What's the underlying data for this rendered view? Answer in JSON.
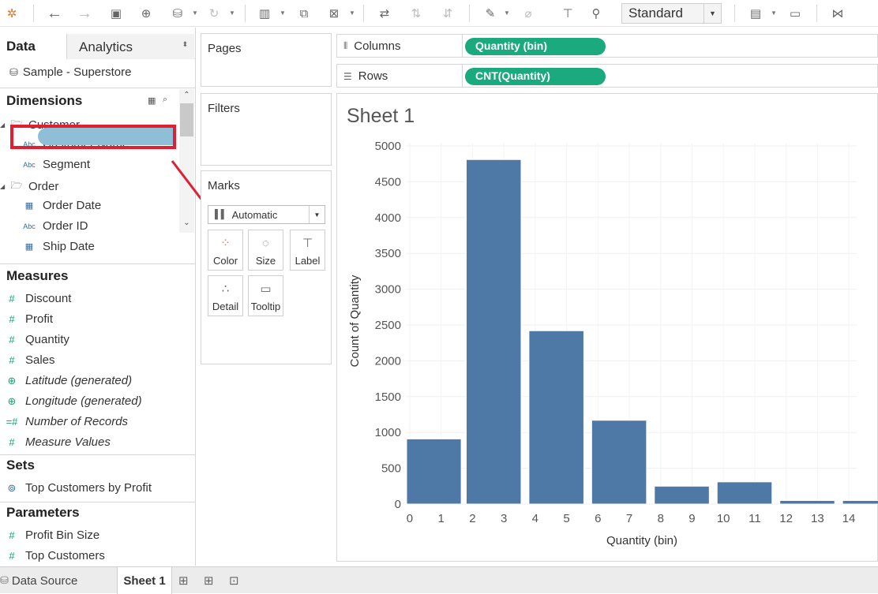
{
  "toolbar": {
    "view_mode": "Standard"
  },
  "data_pane": {
    "tab_data": "Data",
    "tab_analytics": "Analytics",
    "datasource": "Sample - Superstore",
    "dimensions_header": "Dimensions",
    "dimensions": {
      "customer_folder": "Customer",
      "customer_name": "Customer Name",
      "segment": "Segment",
      "order_folder": "Order",
      "order_date": "Order Date",
      "order_id": "Order ID",
      "ship_date": "Ship Date"
    },
    "type_abc": "Abc",
    "measures_header": "Measures",
    "measures": [
      "Discount",
      "Profit",
      "Quantity",
      "Sales",
      "Latitude (generated)",
      "Longitude (generated)",
      "Number of Records",
      "Measure Values"
    ],
    "sets_header": "Sets",
    "sets": [
      "Top Customers by Profit"
    ],
    "parameters_header": "Parameters",
    "parameters": [
      "Profit Bin Size",
      "Top Customers"
    ]
  },
  "cards": {
    "pages": "Pages",
    "filters": "Filters",
    "marks": "Marks",
    "mark_type": "Automatic",
    "mark_buttons": [
      "Color",
      "Size",
      "Label",
      "Detail",
      "Tooltip"
    ]
  },
  "shelves": {
    "columns_label": "Columns",
    "columns_pill": "Quantity (bin)",
    "rows_label": "Rows",
    "rows_pill": "CNT(Quantity)"
  },
  "sheet": {
    "title": "Sheet 1"
  },
  "chart_data": {
    "type": "bar",
    "title": "Sheet 1",
    "xlabel": "Quantity (bin)",
    "ylabel": "Count of Quantity",
    "categories": [
      "0",
      "2",
      "4",
      "6",
      "8",
      "10",
      "12"
    ],
    "values": [
      910,
      4810,
      2420,
      1170,
      250,
      310,
      50,
      50
    ],
    "bin_starts": [
      0,
      2,
      4,
      6,
      8,
      10,
      12,
      14
    ],
    "xticks": [
      "0",
      "1",
      "2",
      "3",
      "4",
      "5",
      "6",
      "7",
      "8",
      "9",
      "10",
      "11",
      "12",
      "13",
      "14"
    ],
    "yticks": [
      "0",
      "500",
      "1000",
      "1500",
      "2000",
      "2500",
      "3000",
      "3500",
      "4000",
      "4500",
      "5000"
    ],
    "ylim": [
      0,
      5000
    ],
    "bar_color": "#4e79a7"
  },
  "bottom": {
    "data_source": "Data Source",
    "sheet_tab": "Sheet 1"
  },
  "colors": {
    "pill": "#1ba97e",
    "highlight_box": "#e02030",
    "bar": "#4e79a7"
  }
}
